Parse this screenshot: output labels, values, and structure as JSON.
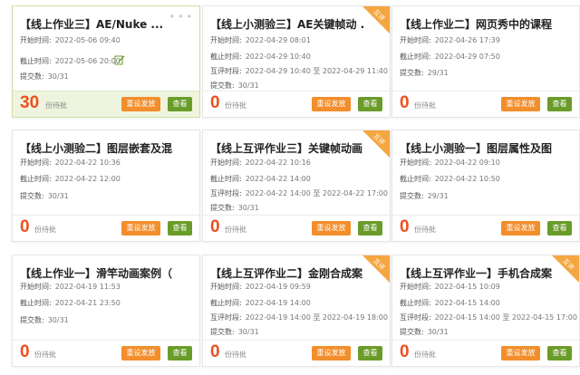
{
  "cards": [
    {
      "title": "【线上作业三】AE/Nuke ...",
      "start_label": "开始时间:",
      "start": "2022-05-06 09:40",
      "end_label": "截止时间:",
      "end": "2022-05-06 20:00",
      "submit_label": "提交数:",
      "submitted": "30/31",
      "pending_count": "30",
      "pending_label": "份待批",
      "reset_label": "重设发放",
      "view_label": "查看"
    },
    {
      "title": "【线上小测验三】AE关键帧动 ...",
      "start_label": "开始时间:",
      "start": "2022-04-29 08:01",
      "end_label": "截止时间:",
      "end": "2022-04-29 10:40",
      "peer_label": "互评时段:",
      "peer": "2022-04-29 10:40 至 2022-04-29 11:40",
      "submit_label": "提交数:",
      "submitted": "30/31",
      "pending_count": "0",
      "pending_label": "份待批",
      "reset_label": "重设发放",
      "view_label": "查看",
      "ribbon": "互评"
    },
    {
      "title": "【线上作业二】网页秀中的课程 ...",
      "start_label": "开始时间:",
      "start": "2022-04-26 17:39",
      "end_label": "截止时间:",
      "end": "2022-04-29 07:50",
      "submit_label": "提交数:",
      "submitted": "29/31",
      "pending_count": "0",
      "pending_label": "份待批",
      "reset_label": "重设发放",
      "view_label": "查看"
    },
    {
      "title": "【线上小测验二】图层嵌套及混 ...",
      "start_label": "开始时间:",
      "start": "2022-04-22 10:36",
      "end_label": "截止时间:",
      "end": "2022-04-22 12:00",
      "submit_label": "提交数:",
      "submitted": "30/31",
      "pending_count": "0",
      "pending_label": "份待批",
      "reset_label": "重设发放",
      "view_label": "查看"
    },
    {
      "title": "【线上互评作业三】关键帧动画 ...",
      "start_label": "开始时间:",
      "start": "2022-04-22 10:16",
      "end_label": "截止时间:",
      "end": "2022-04-22 14:00",
      "peer_label": "互评时段:",
      "peer": "2022-04-22 14:00 至 2022-04-22 17:00",
      "submit_label": "提交数:",
      "submitted": "30/31",
      "pending_count": "0",
      "pending_label": "份待批",
      "reset_label": "重设发放",
      "view_label": "查看",
      "ribbon": "互评"
    },
    {
      "title": "【线上小测验一】图层属性及图 ...",
      "start_label": "开始时间:",
      "start": "2022-04-22 09:10",
      "end_label": "截止时间:",
      "end": "2022-04-22 10:50",
      "submit_label": "提交数:",
      "submitted": "29/31",
      "pending_count": "0",
      "pending_label": "份待批",
      "reset_label": "重设发放",
      "view_label": "查看"
    },
    {
      "title": "【线上作业一】滑竿动画案例（ ...",
      "start_label": "开始时间:",
      "start": "2022-04-19 11:53",
      "end_label": "截止时间:",
      "end": "2022-04-21 23:50",
      "submit_label": "提交数:",
      "submitted": "30/31",
      "pending_count": "0",
      "pending_label": "份待批",
      "reset_label": "重设发放",
      "view_label": "查看"
    },
    {
      "title": "【线上互评作业二】金刚合成案 ...",
      "start_label": "开始时间:",
      "start": "2022-04-19 09:59",
      "end_label": "截止时间:",
      "end": "2022-04-19 14:00",
      "peer_label": "互评时段:",
      "peer": "2022-04-19 14:00 至 2022-04-19 18:00",
      "submit_label": "提交数:",
      "submitted": "30/31",
      "pending_count": "0",
      "pending_label": "份待批",
      "reset_label": "重设发放",
      "view_label": "查看",
      "ribbon": "互评"
    },
    {
      "title": "【线上互评作业一】手机合成案 ...",
      "start_label": "开始时间:",
      "start": "2022-04-15 10:09",
      "end_label": "截止时间:",
      "end": "2022-04-15 14:00",
      "peer_label": "互评时段:",
      "peer": "2022-04-15 14:00 至 2022-04-15 17:00",
      "submit_label": "提交数:",
      "submitted": "30/31",
      "pending_count": "0",
      "pending_label": "份待批",
      "reset_label": "重设发放",
      "view_label": "查看",
      "ribbon": "互评"
    }
  ],
  "colors": {
    "count": "#ee4f1f",
    "reset_button": "#f28e2b",
    "view_button": "#6a9c2a",
    "ribbon": "#f4a640",
    "selected_footer": "#eef4de"
  },
  "icons": {
    "more": "more-dots-icon",
    "edit": "edit-pencil-icon"
  }
}
